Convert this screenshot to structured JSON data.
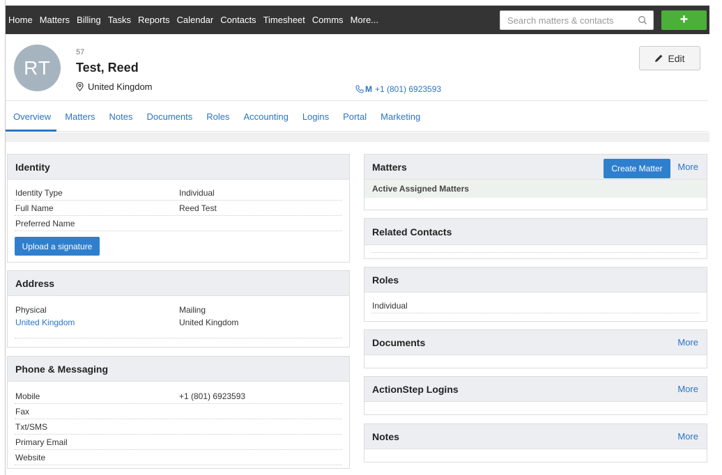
{
  "nav": {
    "items": [
      "Home",
      "Matters",
      "Billing",
      "Tasks",
      "Reports",
      "Calendar",
      "Contacts",
      "Timesheet",
      "Comms",
      "More..."
    ],
    "search_placeholder": "Search matters & contacts",
    "add_label": "+"
  },
  "contact": {
    "initials": "RT",
    "id": "57",
    "name": "Test, Reed",
    "location": "United Kingdom",
    "mobile_label": "M",
    "mobile": "+1 (801) 6923593",
    "edit_label": "Edit"
  },
  "tabs": [
    "Overview",
    "Matters",
    "Notes",
    "Documents",
    "Roles",
    "Accounting",
    "Logins",
    "Portal",
    "Marketing"
  ],
  "identity": {
    "title": "Identity",
    "rows": [
      {
        "label": "Identity Type",
        "value": "Individual"
      },
      {
        "label": "Full Name",
        "value": "Reed Test"
      },
      {
        "label": "Preferred Name",
        "value": ""
      }
    ],
    "upload_label": "Upload a signature"
  },
  "address": {
    "title": "Address",
    "physical_label": "Physical",
    "physical_value": "United Kingdom",
    "mailing_label": "Mailing",
    "mailing_value": "United Kingdom"
  },
  "phone": {
    "title": "Phone & Messaging",
    "rows": [
      {
        "label": "Mobile",
        "value": "+1 (801) 6923593"
      },
      {
        "label": "Fax",
        "value": ""
      },
      {
        "label": "Txt/SMS",
        "value": ""
      },
      {
        "label": "Primary Email",
        "value": ""
      },
      {
        "label": "Website",
        "value": ""
      }
    ]
  },
  "matters": {
    "title": "Matters",
    "create_label": "Create Matter",
    "more_label": "More",
    "subheader": "Active Assigned Matters"
  },
  "related": {
    "title": "Related Contacts"
  },
  "roles": {
    "title": "Roles",
    "item": "Individual"
  },
  "documents": {
    "title": "Documents",
    "more_label": "More"
  },
  "logins": {
    "title": "ActionStep Logins",
    "more_label": "More"
  },
  "notes": {
    "title": "Notes",
    "more_label": "More"
  },
  "colors": {
    "nav_bg": "#343434",
    "accent": "#2a74c3",
    "add_button": "#4caf3a",
    "avatar": "#a6b4bf"
  }
}
